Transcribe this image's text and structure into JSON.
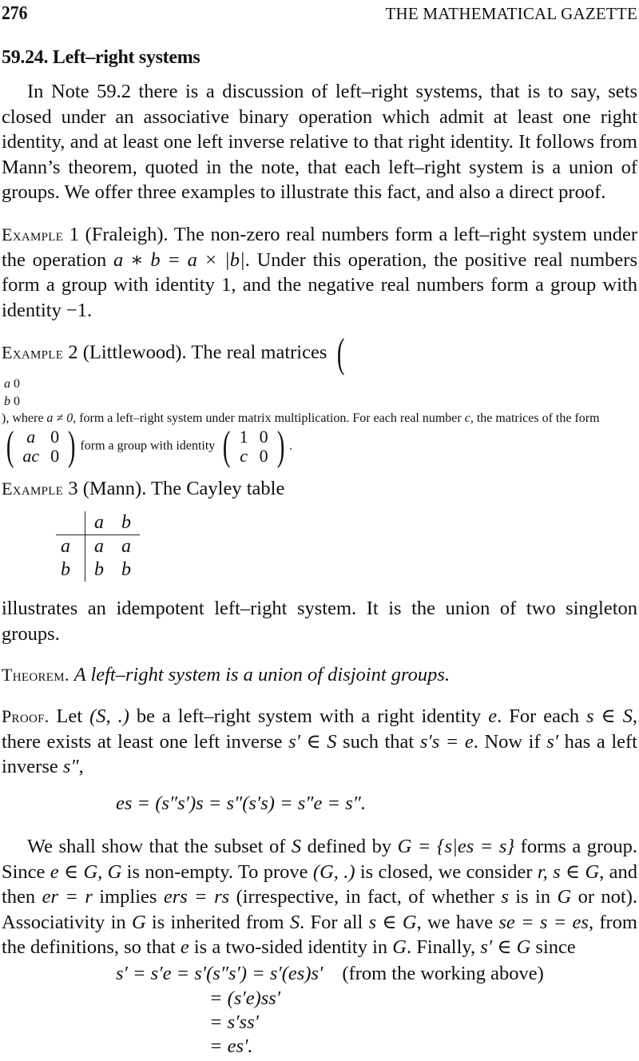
{
  "header": {
    "page_number": "276",
    "journal_title": "THE MATHEMATICAL GAZETTE"
  },
  "note": {
    "title": "59.24. Left–right systems"
  },
  "intro": {
    "text": "In Note 59.2 there is a discussion of left–right systems, that is to say, sets closed under an associative binary operation which admit at least one right identity, and at least one left inverse relative to that right identity. It follows from Mann’s theorem, quoted in the note, that each left–right system is a union of groups. We offer three examples to illustrate this fact, and also a direct proof."
  },
  "example1": {
    "label": "Example",
    "number": "1",
    "text_a": "(Fraleigh). The non-zero real numbers form a left–right system under the operation ",
    "formula": "a ∗ b = a × |b|",
    "text_b": ". Under this operation, the positive real numbers form a group with identity 1, and the negative real numbers form a group with identity −1."
  },
  "example2": {
    "label": "Example",
    "number": "2",
    "text_a": "(Littlewood). The real matrices",
    "matrix1": [
      [
        "a",
        "0"
      ],
      [
        "b",
        "0"
      ]
    ],
    "text_b": ", where ",
    "cond": "a ≠ 0",
    "text_c": ", form a left–right system under matrix multiplication. For each real number ",
    "var_c": "c",
    "text_d": ", the matrices of the form",
    "matrix2": [
      [
        "a",
        "0"
      ],
      [
        "ac",
        "0"
      ]
    ],
    "text_e": "form a group with identity",
    "matrix3": [
      [
        "1",
        "0"
      ],
      [
        "c",
        "0"
      ]
    ],
    "text_f": "."
  },
  "example3": {
    "label": "Example",
    "number": "3",
    "text": "(Mann). The Cayley table",
    "cayley": {
      "columns": [
        "a",
        "b"
      ],
      "rows": [
        {
          "head": "a",
          "cells": [
            "a",
            "a"
          ]
        },
        {
          "head": "b",
          "cells": [
            "b",
            "b"
          ]
        }
      ]
    },
    "after": "illustrates an idempotent left–right system. It is the union of two singleton groups."
  },
  "theorem": {
    "label": "Theorem.",
    "statement": "A left–right system is a union of disjoint groups."
  },
  "proof": {
    "label": "Proof.",
    "p1_a": "Let ",
    "p1_s": "(S, .)",
    "p1_b": " be a left–right system with a right identity ",
    "p1_e": "e",
    "p1_c": ". For each ",
    "p1_sinS": "s ∈ S",
    "p1_d": ", there exists at least one left inverse ",
    "p1_sp": "s′ ∈ S",
    "p1_e2": " such that ",
    "p1_eq": "s′s = e",
    "p1_f": ". Now if ",
    "p1_sp2": "s′",
    "p1_g": " has a left inverse ",
    "p1_spp": "s″",
    "p1_h": ",",
    "eq1": "es = (s″s′)s = s″(s′s) = s″e = s″.",
    "p2": [
      {
        "t": "We shall show that the subset of "
      },
      {
        "m": "S"
      },
      {
        "t": " defined by "
      },
      {
        "m": "G = {s|es = s}"
      },
      {
        "t": " forms a group. Since "
      },
      {
        "m": "e ∈ G, G"
      },
      {
        "t": " is non-empty. To prove "
      },
      {
        "m": "(G, .)"
      },
      {
        "t": " is closed, we consider "
      },
      {
        "m": "r, s ∈ G"
      },
      {
        "t": ", and then "
      },
      {
        "m": "er = r"
      },
      {
        "t": " implies "
      },
      {
        "m": "ers = rs"
      },
      {
        "t": " (irrespective, in fact, of whether "
      },
      {
        "m": "s"
      },
      {
        "t": " is in "
      },
      {
        "m": "G"
      },
      {
        "t": " or not). Associativity in "
      },
      {
        "m": "G"
      },
      {
        "t": " is inherited from "
      },
      {
        "m": "S"
      },
      {
        "t": ". For all "
      },
      {
        "m": "s ∈ G"
      },
      {
        "t": ", we have "
      },
      {
        "m": "se = s = es"
      },
      {
        "t": ", from the definitions, so that "
      },
      {
        "m": "e"
      },
      {
        "t": " is a two-sided identity in "
      },
      {
        "m": "G"
      },
      {
        "t": ". Finally, "
      },
      {
        "m": "s′ ∈ G"
      },
      {
        "t": " since"
      }
    ],
    "derivation": [
      {
        "lhs": "s′ = s′e = s′(s″s′) ",
        "rhs": "= s′(es)s′",
        "note": "(from the working above)"
      },
      {
        "lhs": "",
        "rhs": "= (s′e)ss′",
        "note": ""
      },
      {
        "lhs": "",
        "rhs": "= s′ss′",
        "note": ""
      },
      {
        "lhs": "",
        "rhs": "= es′.",
        "note": ""
      }
    ]
  }
}
